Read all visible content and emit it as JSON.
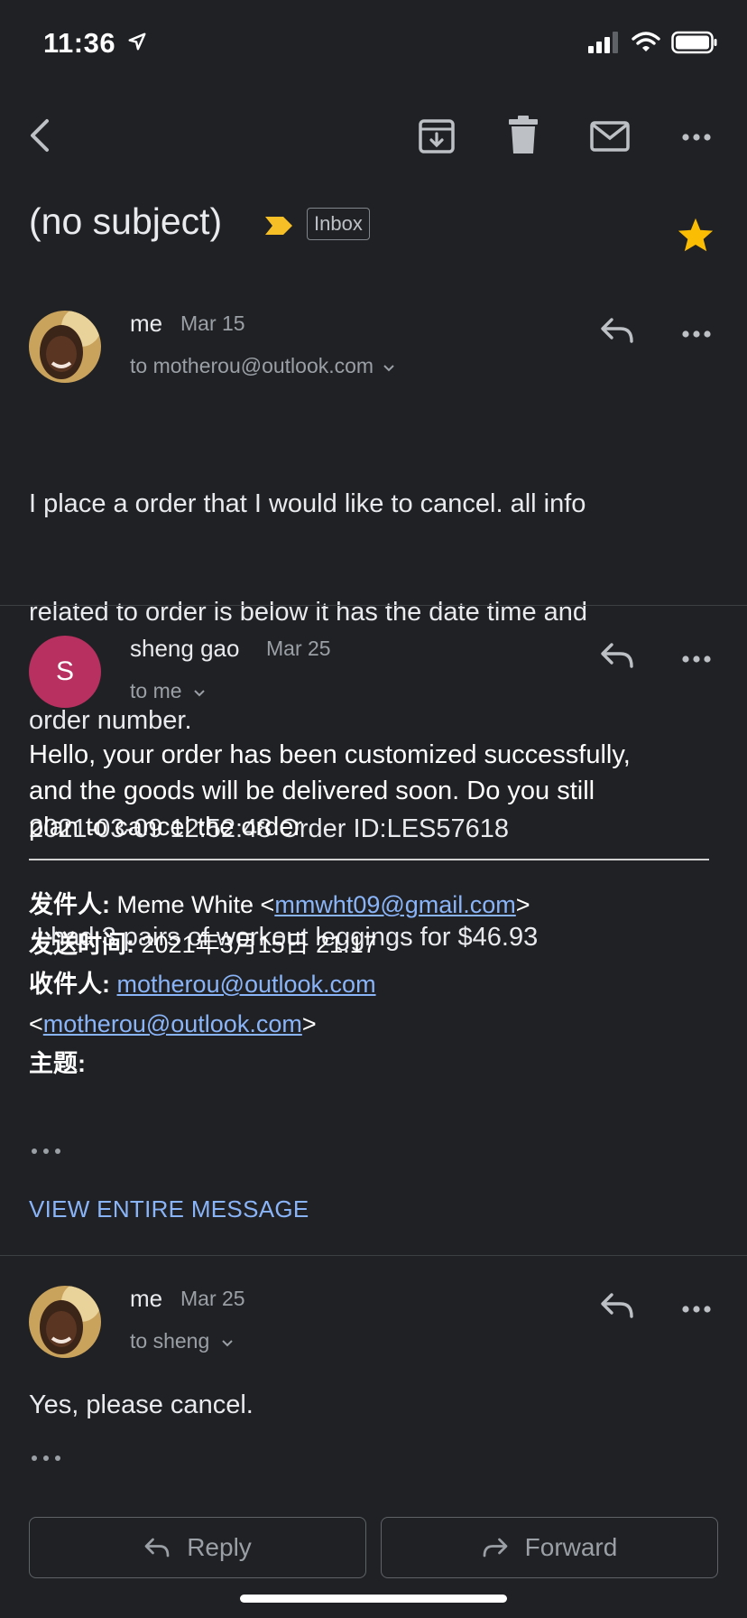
{
  "status": {
    "time": "11:36"
  },
  "subject": {
    "title": "(no subject)",
    "label": "Inbox"
  },
  "messages": [
    {
      "sender": "me",
      "date": "Mar 15",
      "to": "to motherou@outlook.com",
      "body": [
        "I place a order that I would like to cancel. all info",
        "related to order is below it has the date time and",
        "order number.",
        "2021-03-09 12:52:48 Order ID:LES57618",
        " I had 3 pairs of workout leggings for $46.93"
      ]
    },
    {
      "sender": "sheng gao",
      "avatar_letter": "S",
      "avatar_color": "#b7305f",
      "date": "Mar 25",
      "to": "to me",
      "body": [
        "Hello, your order has been customized successfully,",
        "and the goods will be delivered soon. Do you still",
        "plan to cancel the order"
      ],
      "quoted": {
        "from_label": "发件人:",
        "from_name": "Meme White <",
        "from_email": "mmwht09@gmail.com",
        "from_close": ">",
        "sent_label": "发送时间:",
        "sent_value": "2021年3月15日 21:17",
        "to_label": "收件人:",
        "to_email": "motherou@outlook.com",
        "to_open": "<",
        "to_email2": "motherou@outlook.com",
        "to_close": ">",
        "subject_label": "主题:"
      },
      "view_entire": "VIEW ENTIRE MESSAGE"
    },
    {
      "sender": "me",
      "date": "Mar 25",
      "to": "to sheng",
      "body": [
        "Yes, please cancel."
      ]
    }
  ],
  "actions": {
    "reply": "Reply",
    "forward": "Forward"
  },
  "colors": {
    "background": "#202124",
    "star": "#fbbc04",
    "link": "#8ab4f8",
    "important": "#f6bf26"
  }
}
